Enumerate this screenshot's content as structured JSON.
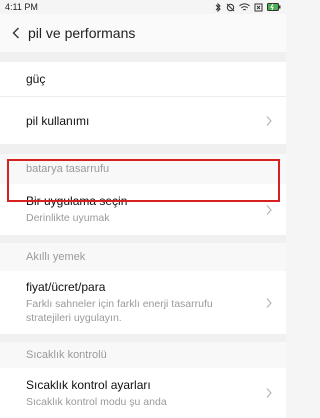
{
  "status_bar": {
    "time": "4:11 PM",
    "icons": [
      "bluetooth-icon",
      "alarm-off-icon",
      "wifi-icon",
      "battery-x-icon",
      "battery-charging-icon"
    ]
  },
  "header": {
    "title": "pil ve performans",
    "back_icon": "chevron-left-icon"
  },
  "group1": {
    "items": [
      {
        "title": "güç"
      },
      {
        "title": "pil kullanımı"
      }
    ]
  },
  "section2": {
    "header": "batarya tasarrufu",
    "items": [
      {
        "title": "Bir uygulama seçin",
        "subtitle": "Derinlikte uyumak"
      }
    ]
  },
  "section3": {
    "header": "Akıllı yemek",
    "items": [
      {
        "title": "fiyat/ücret/para",
        "subtitle": "Farklı sahneler için farklı enerji tasarrufu stratejileri uygulayın."
      }
    ]
  },
  "section4": {
    "header": "Sıcaklık kontrolü",
    "items": [
      {
        "title": "Sıcaklık kontrol ayarları",
        "subtitle": "Sıcaklık kontrol modu şu anda"
      }
    ]
  },
  "highlight_color": "#d62121"
}
